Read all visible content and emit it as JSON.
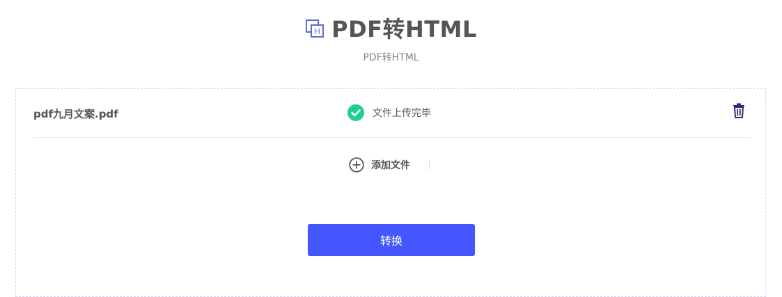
{
  "header": {
    "title": "PDF转HTML",
    "subtitle": "PDF转HTML",
    "icon": "pdf-to-html-icon"
  },
  "files": [
    {
      "name": "pdf九月文案.pdf",
      "status_text": "文件上传完毕",
      "status_icon": "check-circle-icon",
      "status_color": "#1ecf8f"
    }
  ],
  "add_file": {
    "label": "添加文件",
    "icon": "plus-circle-icon"
  },
  "convert_button": {
    "label": "转换"
  },
  "colors": {
    "accent": "#4457ff",
    "icon_blue": "#5e6ad2",
    "delete_icon": "#2c2f78",
    "success": "#1ecf8f"
  }
}
